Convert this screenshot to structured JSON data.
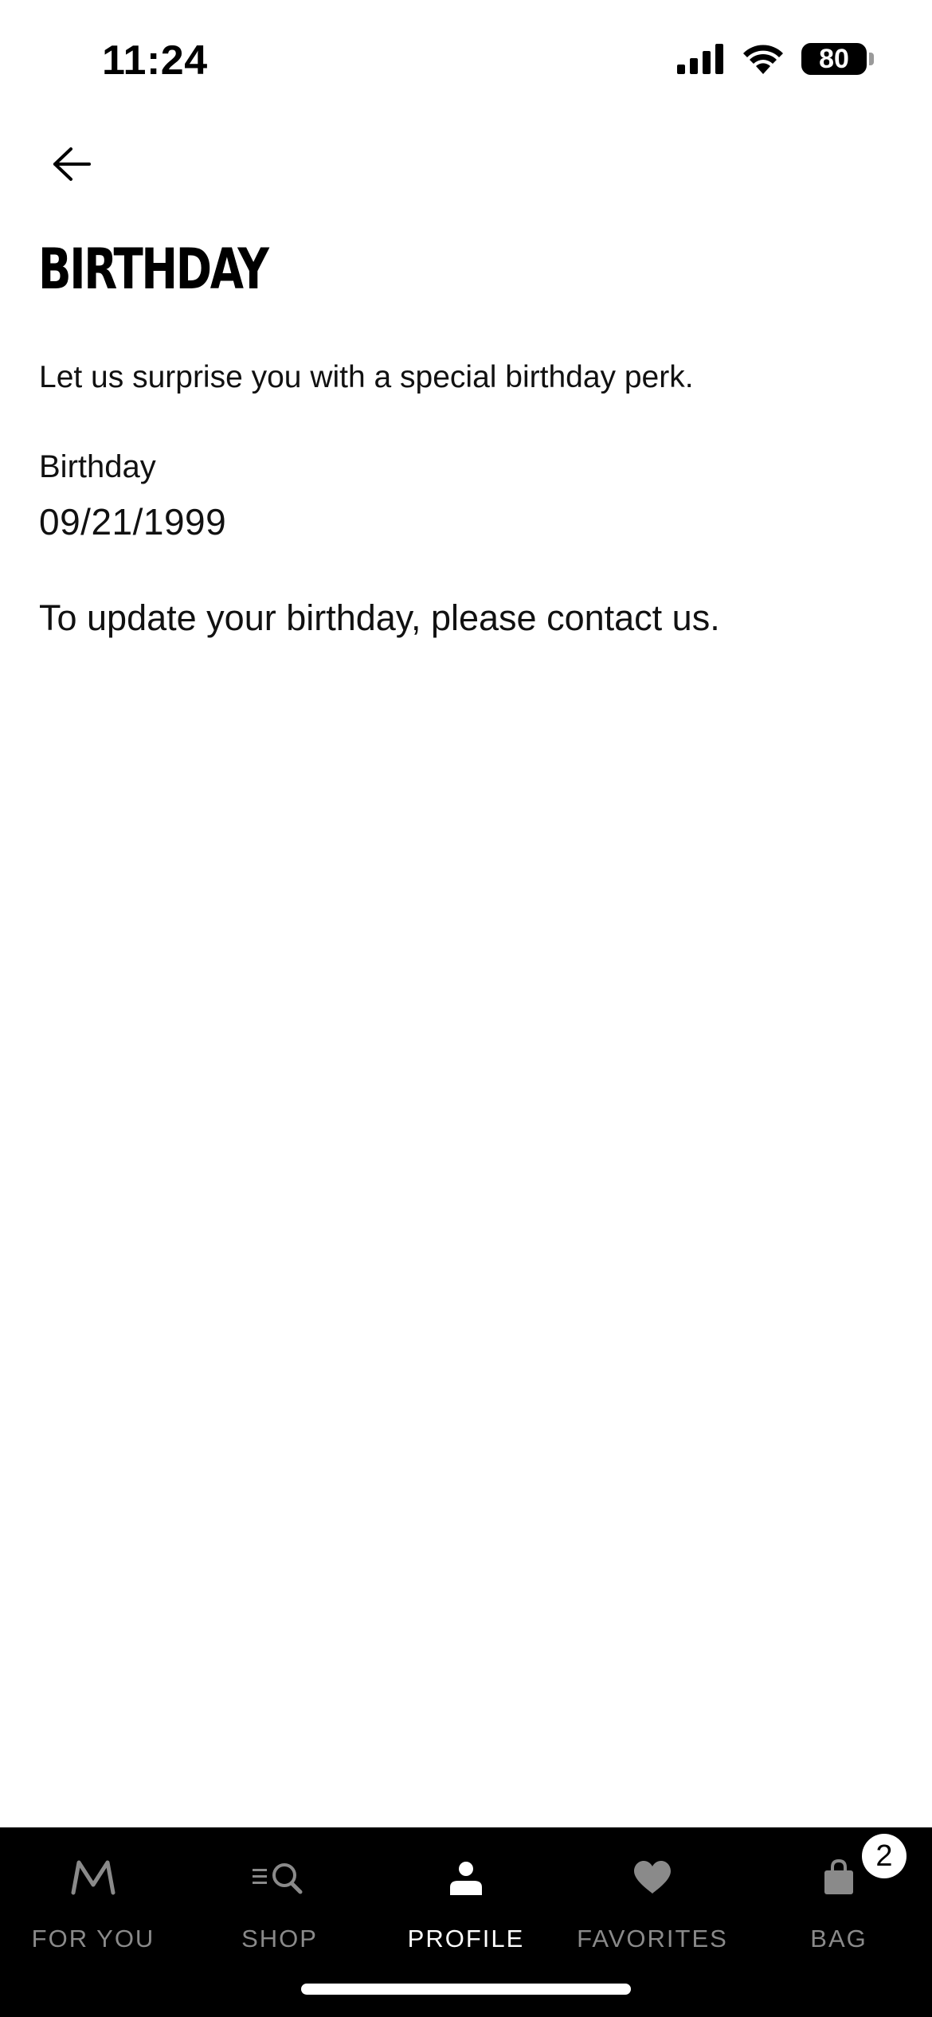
{
  "status_bar": {
    "time": "11:24",
    "battery": "80",
    "icons": [
      "signal-icon",
      "wifi-icon",
      "battery-icon"
    ]
  },
  "header": {
    "back_icon": "arrow-left-icon"
  },
  "page": {
    "title": "BIRTHDAY",
    "intro": "Let us surprise you with a special birthday perk.",
    "field_label": "Birthday",
    "field_value": "09/21/1999",
    "contact_note": "To update your birthday, please contact us."
  },
  "tab_bar": {
    "active": "PROFILE",
    "tabs": [
      {
        "label": "FOR YOU",
        "icon": "m-logo-icon"
      },
      {
        "label": "SHOP",
        "icon": "menu-search-icon"
      },
      {
        "label": "PROFILE",
        "icon": "person-icon"
      },
      {
        "label": "FAVORITES",
        "icon": "heart-icon"
      },
      {
        "label": "BAG",
        "icon": "bag-icon",
        "badge": "2"
      }
    ]
  },
  "colors": {
    "background": "#ffffff",
    "text": "#111111",
    "tab_bar_bg": "#000000",
    "tab_inactive": "#8a8a8a",
    "tab_active": "#ffffff"
  }
}
